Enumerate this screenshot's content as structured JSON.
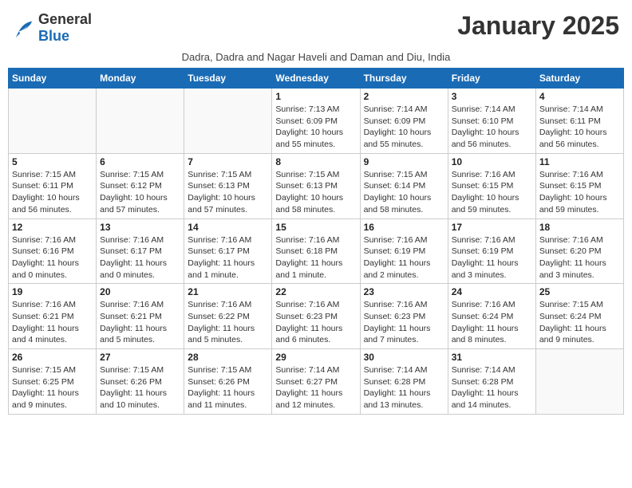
{
  "logo": {
    "line1": "General",
    "line2": "Blue"
  },
  "month_title": "January 2025",
  "subtitle": "Dadra, Dadra and Nagar Haveli and Daman and Diu, India",
  "days_of_week": [
    "Sunday",
    "Monday",
    "Tuesday",
    "Wednesday",
    "Thursday",
    "Friday",
    "Saturday"
  ],
  "weeks": [
    [
      {
        "day": "",
        "info": ""
      },
      {
        "day": "",
        "info": ""
      },
      {
        "day": "",
        "info": ""
      },
      {
        "day": "1",
        "info": "Sunrise: 7:13 AM\nSunset: 6:09 PM\nDaylight: 10 hours and 55 minutes."
      },
      {
        "day": "2",
        "info": "Sunrise: 7:14 AM\nSunset: 6:09 PM\nDaylight: 10 hours and 55 minutes."
      },
      {
        "day": "3",
        "info": "Sunrise: 7:14 AM\nSunset: 6:10 PM\nDaylight: 10 hours and 56 minutes."
      },
      {
        "day": "4",
        "info": "Sunrise: 7:14 AM\nSunset: 6:11 PM\nDaylight: 10 hours and 56 minutes."
      }
    ],
    [
      {
        "day": "5",
        "info": "Sunrise: 7:15 AM\nSunset: 6:11 PM\nDaylight: 10 hours and 56 minutes."
      },
      {
        "day": "6",
        "info": "Sunrise: 7:15 AM\nSunset: 6:12 PM\nDaylight: 10 hours and 57 minutes."
      },
      {
        "day": "7",
        "info": "Sunrise: 7:15 AM\nSunset: 6:13 PM\nDaylight: 10 hours and 57 minutes."
      },
      {
        "day": "8",
        "info": "Sunrise: 7:15 AM\nSunset: 6:13 PM\nDaylight: 10 hours and 58 minutes."
      },
      {
        "day": "9",
        "info": "Sunrise: 7:15 AM\nSunset: 6:14 PM\nDaylight: 10 hours and 58 minutes."
      },
      {
        "day": "10",
        "info": "Sunrise: 7:16 AM\nSunset: 6:15 PM\nDaylight: 10 hours and 59 minutes."
      },
      {
        "day": "11",
        "info": "Sunrise: 7:16 AM\nSunset: 6:15 PM\nDaylight: 10 hours and 59 minutes."
      }
    ],
    [
      {
        "day": "12",
        "info": "Sunrise: 7:16 AM\nSunset: 6:16 PM\nDaylight: 11 hours and 0 minutes."
      },
      {
        "day": "13",
        "info": "Sunrise: 7:16 AM\nSunset: 6:17 PM\nDaylight: 11 hours and 0 minutes."
      },
      {
        "day": "14",
        "info": "Sunrise: 7:16 AM\nSunset: 6:17 PM\nDaylight: 11 hours and 1 minute."
      },
      {
        "day": "15",
        "info": "Sunrise: 7:16 AM\nSunset: 6:18 PM\nDaylight: 11 hours and 1 minute."
      },
      {
        "day": "16",
        "info": "Sunrise: 7:16 AM\nSunset: 6:19 PM\nDaylight: 11 hours and 2 minutes."
      },
      {
        "day": "17",
        "info": "Sunrise: 7:16 AM\nSunset: 6:19 PM\nDaylight: 11 hours and 3 minutes."
      },
      {
        "day": "18",
        "info": "Sunrise: 7:16 AM\nSunset: 6:20 PM\nDaylight: 11 hours and 3 minutes."
      }
    ],
    [
      {
        "day": "19",
        "info": "Sunrise: 7:16 AM\nSunset: 6:21 PM\nDaylight: 11 hours and 4 minutes."
      },
      {
        "day": "20",
        "info": "Sunrise: 7:16 AM\nSunset: 6:21 PM\nDaylight: 11 hours and 5 minutes."
      },
      {
        "day": "21",
        "info": "Sunrise: 7:16 AM\nSunset: 6:22 PM\nDaylight: 11 hours and 5 minutes."
      },
      {
        "day": "22",
        "info": "Sunrise: 7:16 AM\nSunset: 6:23 PM\nDaylight: 11 hours and 6 minutes."
      },
      {
        "day": "23",
        "info": "Sunrise: 7:16 AM\nSunset: 6:23 PM\nDaylight: 11 hours and 7 minutes."
      },
      {
        "day": "24",
        "info": "Sunrise: 7:16 AM\nSunset: 6:24 PM\nDaylight: 11 hours and 8 minutes."
      },
      {
        "day": "25",
        "info": "Sunrise: 7:15 AM\nSunset: 6:24 PM\nDaylight: 11 hours and 9 minutes."
      }
    ],
    [
      {
        "day": "26",
        "info": "Sunrise: 7:15 AM\nSunset: 6:25 PM\nDaylight: 11 hours and 9 minutes."
      },
      {
        "day": "27",
        "info": "Sunrise: 7:15 AM\nSunset: 6:26 PM\nDaylight: 11 hours and 10 minutes."
      },
      {
        "day": "28",
        "info": "Sunrise: 7:15 AM\nSunset: 6:26 PM\nDaylight: 11 hours and 11 minutes."
      },
      {
        "day": "29",
        "info": "Sunrise: 7:14 AM\nSunset: 6:27 PM\nDaylight: 11 hours and 12 minutes."
      },
      {
        "day": "30",
        "info": "Sunrise: 7:14 AM\nSunset: 6:28 PM\nDaylight: 11 hours and 13 minutes."
      },
      {
        "day": "31",
        "info": "Sunrise: 7:14 AM\nSunset: 6:28 PM\nDaylight: 11 hours and 14 minutes."
      },
      {
        "day": "",
        "info": ""
      }
    ]
  ]
}
